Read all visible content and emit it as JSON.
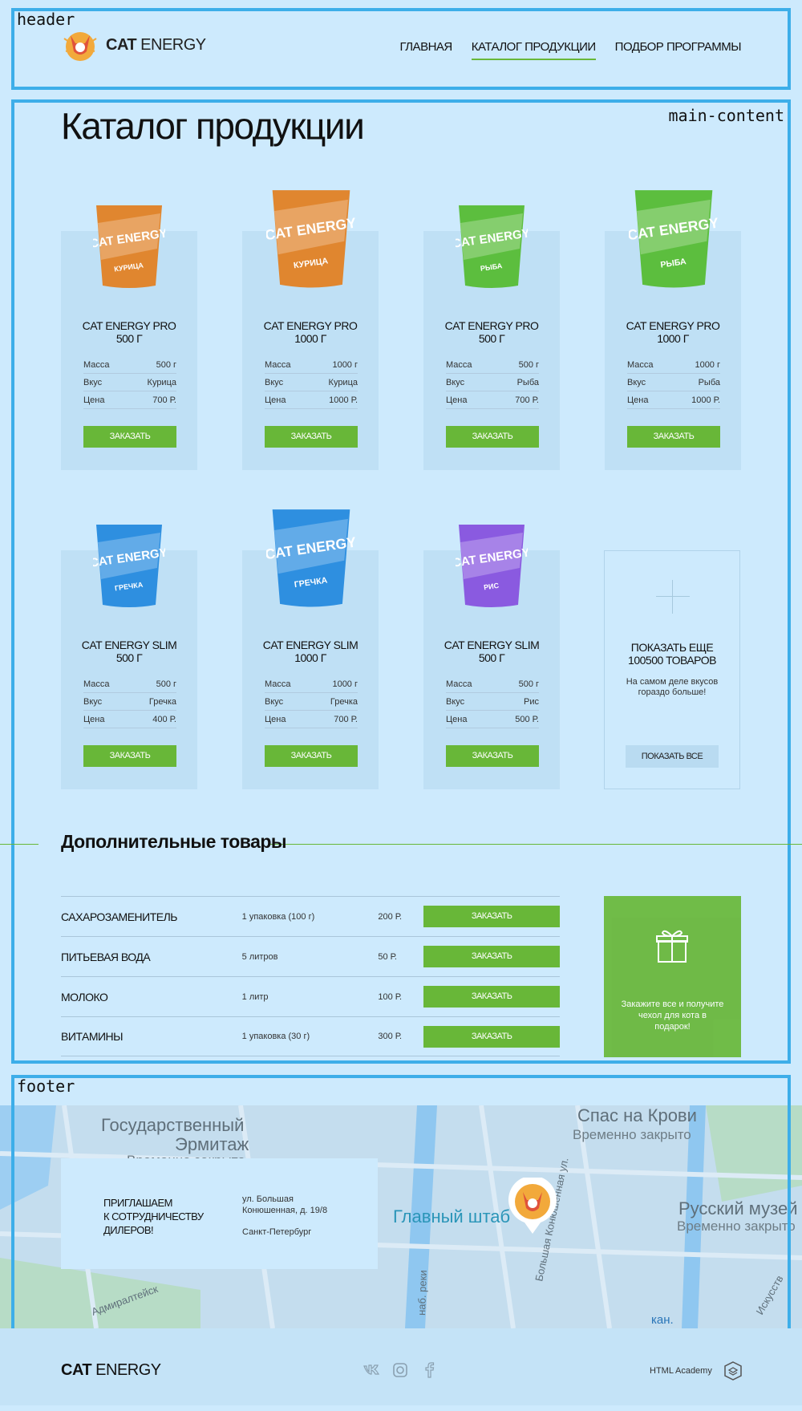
{
  "annotations": {
    "header": "header",
    "main": "main-content",
    "footer": "footer"
  },
  "header": {
    "logo_bold": "CAT",
    "logo_light": " ENERGY",
    "nav": [
      {
        "label": "ГЛАВНАЯ",
        "active": false
      },
      {
        "label": "КАТАЛОГ ПРОДУКЦИИ",
        "active": true
      },
      {
        "label": "ПОДБОР ПРОГРАММЫ",
        "active": false
      }
    ]
  },
  "catalog": {
    "title": "Каталог продукции",
    "spec_labels": {
      "mass": "Масса",
      "taste": "Вкус",
      "price": "Цена"
    },
    "order_label": "ЗАКАЗАТЬ",
    "products": [
      {
        "name1": "CAT ENERGY PRO",
        "name2": "500 Г",
        "mass": "500 г",
        "taste": "Курица",
        "price": "700 Р.",
        "pack_color": "#e0862f",
        "pack_label": "КУРИЦА"
      },
      {
        "name1": "CAT ENERGY PRO",
        "name2": "1000 Г",
        "mass": "1000 г",
        "taste": "Курица",
        "price": "1000 Р.",
        "pack_color": "#e0862f",
        "pack_label": "КУРИЦА"
      },
      {
        "name1": "CAT ENERGY PRO",
        "name2": "500 Г",
        "mass": "500 г",
        "taste": "Рыба",
        "price": "700 Р.",
        "pack_color": "#5cbe3e",
        "pack_label": "РЫБА"
      },
      {
        "name1": "CAT ENERGY PRO",
        "name2": "1000 Г",
        "mass": "1000 г",
        "taste": "Рыба",
        "price": "1000 Р.",
        "pack_color": "#5cbe3e",
        "pack_label": "РЫБА"
      },
      {
        "name1": "CAT ENERGY SLIM",
        "name2": "500 Г",
        "mass": "500 г",
        "taste": "Гречка",
        "price": "400 Р.",
        "pack_color": "#2e8fe0",
        "pack_label": "ГРЕЧКА"
      },
      {
        "name1": "CAT ENERGY SLIM",
        "name2": "1000 Г",
        "mass": "1000 г",
        "taste": "Гречка",
        "price": "700 Р.",
        "pack_color": "#2e8fe0",
        "pack_label": "ГРЕЧКА"
      },
      {
        "name1": "CAT ENERGY SLIM",
        "name2": "500 Г",
        "mass": "500 г",
        "taste": "Рис",
        "price": "500 Р.",
        "pack_color": "#8a5ae0",
        "pack_label": "РИС"
      }
    ],
    "pack_brand": "CAT ENERGY",
    "more": {
      "title1": "ПОКАЗАТЬ ЕЩЕ",
      "title2": "100500 ТОВАРОВ",
      "desc": "На самом деле вкусов гораздо больше!",
      "button": "ПОКАЗАТЬ ВСЕ"
    }
  },
  "extras": {
    "title": "Дополнительные товары",
    "items": [
      {
        "name": "САХАРОЗАМЕНИТЕЛЬ",
        "amount": "1 упаковка (100 г)",
        "price": "200 Р."
      },
      {
        "name": "ПИТЬЕВАЯ ВОДА",
        "amount": "5 литров",
        "price": "50 Р."
      },
      {
        "name": "МОЛОКО",
        "amount": "1 литр",
        "price": "100 Р."
      },
      {
        "name": "ВИТАМИНЫ",
        "amount": "1 упаковка (30 г)",
        "price": "300 Р."
      }
    ],
    "gift": "Закажите все и получите чехол для кота в подарок!"
  },
  "map": {
    "labels": [
      "Государственный",
      "Эрмитаж",
      "Временно закрыто",
      "Спас на Крови",
      "Временно закрыто",
      "Главный штаб",
      "Русский музей",
      "Временно закрыто",
      "Большая Конюшенная ул.",
      "наб. реки",
      "Адмиралтейск",
      "Искусств",
      "кан."
    ]
  },
  "contact": {
    "invite": [
      "ПРИГЛАШАЕМ",
      "К СОТРУДНИЧЕСТВУ",
      "ДИЛЕРОВ!"
    ],
    "address": [
      "ул. Большая",
      "Конюшенная, д. 19/8"
    ],
    "city": "Санкт-Петербург"
  },
  "footer": {
    "logo_bold": "CAT",
    "logo_light": " ENERGY",
    "social": [
      "vk-icon",
      "instagram-icon",
      "facebook-icon"
    ],
    "academy": "HTML Academy"
  },
  "colors": {
    "accent": "#68b738",
    "overlay": "#cdeafd",
    "region_border": "#3daee9"
  }
}
